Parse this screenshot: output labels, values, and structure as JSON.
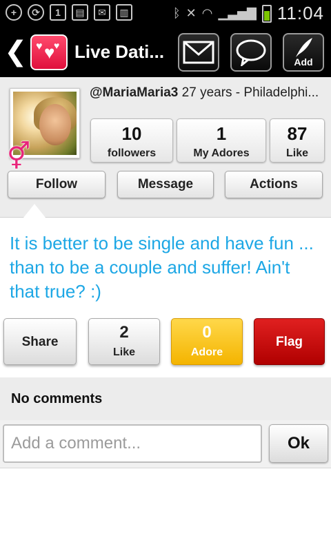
{
  "status_bar": {
    "clock": "11:04",
    "icons": [
      "add-icon",
      "sync-icon",
      "calendar-icon",
      "sim-icon",
      "mail-icon",
      "book-icon",
      "bluetooth-icon",
      "mute-icon",
      "wifi-icon",
      "signal-icon",
      "battery-icon"
    ],
    "calendar_day": "1",
    "battery_color": "#7cc400"
  },
  "action_bar": {
    "title": "Live Dati...",
    "add_label": "Add",
    "logo_color": "#e0103d"
  },
  "profile": {
    "username": "@MariaMaria3",
    "details": "27 years - Philadelphi...",
    "gender_icon": "female-icon",
    "gender_color": "#e8247a",
    "stats": [
      {
        "value": "10",
        "label": "followers"
      },
      {
        "value": "1",
        "label": "My Adores"
      },
      {
        "value": "87",
        "label": "Like"
      }
    ],
    "buttons": {
      "follow": "Follow",
      "message": "Message",
      "actions": "Actions"
    }
  },
  "post": {
    "text": "It is better to be single and have fun ... than to be a couple and suffer! Ain't that true? :)",
    "text_color": "#1da7e5"
  },
  "reactions": {
    "share": "Share",
    "like": {
      "count": "2",
      "label": "Like"
    },
    "adore": {
      "count": "0",
      "label": "Adore",
      "color": "#f4b400"
    },
    "flag": {
      "label": "Flag",
      "color": "#b00000"
    }
  },
  "comments": {
    "empty_text": "No comments",
    "input_placeholder": "Add a comment...",
    "submit_label": "Ok"
  }
}
